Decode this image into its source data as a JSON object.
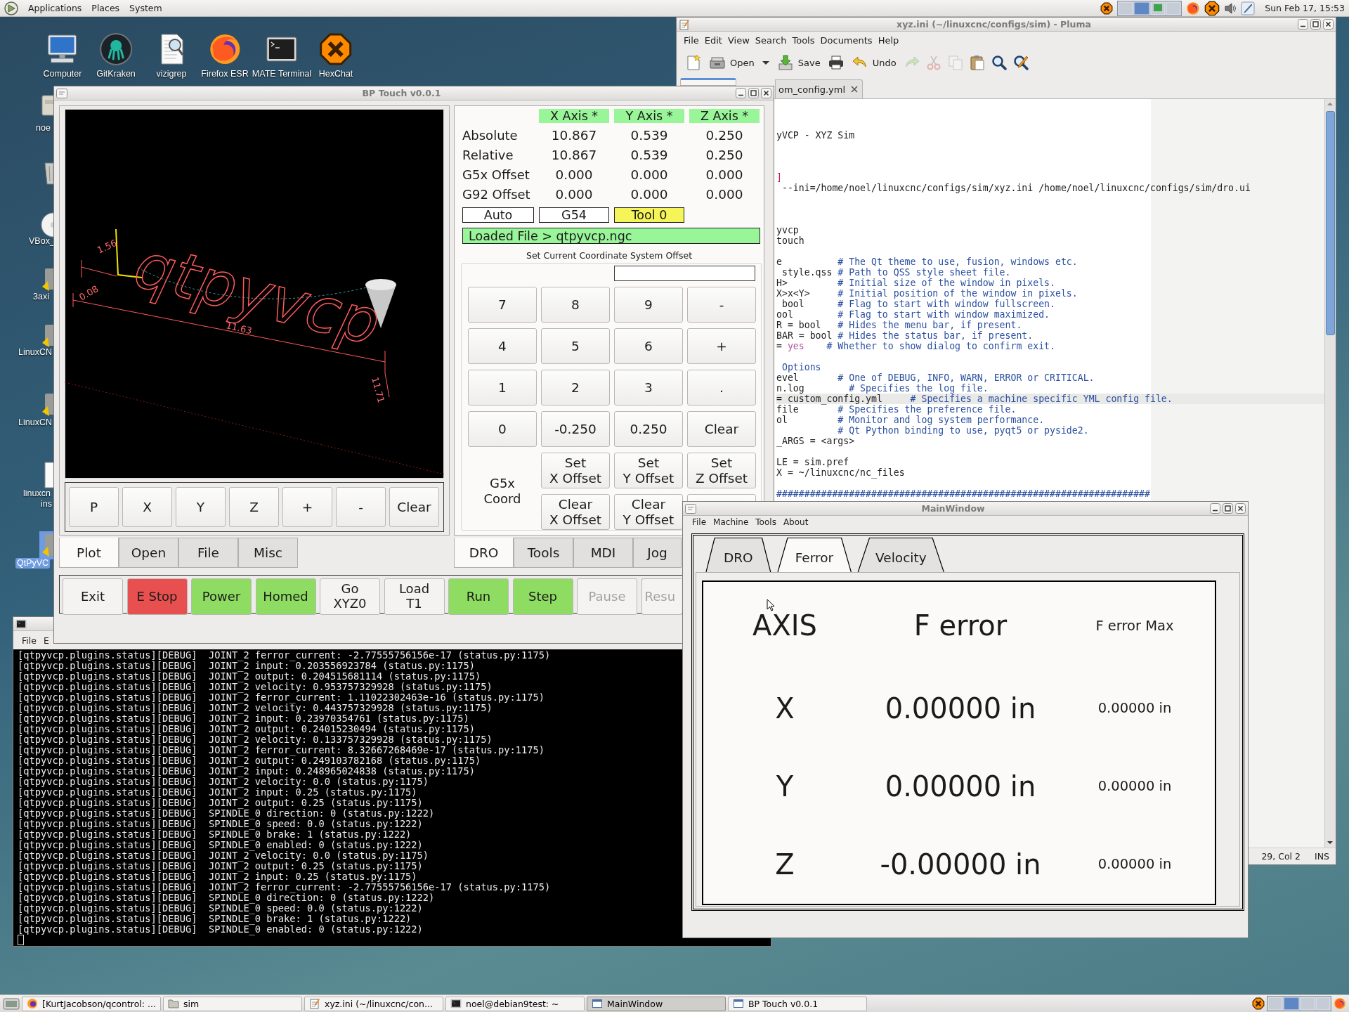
{
  "top_panel": {
    "menus": [
      "Applications",
      "Places",
      "System"
    ],
    "clock": "Sun Feb 17, 15:53"
  },
  "desktop_icons": [
    {
      "label": "Computer",
      "kind": "computer"
    },
    {
      "label": "GitKraken",
      "kind": "gitkraken"
    },
    {
      "label": "vizigrep",
      "kind": "document-search"
    },
    {
      "label": "Firefox ESR",
      "kind": "firefox"
    },
    {
      "label": "MATE Terminal",
      "kind": "terminal"
    },
    {
      "label": "HexChat",
      "kind": "hexchat"
    }
  ],
  "desktop_left_icons": [
    {
      "kind": "home-folder",
      "lines": [
        "noe"
      ],
      "selected": false
    },
    {
      "kind": "trash",
      "selected": false
    },
    {
      "kind": "disc",
      "lines": [
        "VBox_"
      ],
      "selected": false
    },
    {
      "kind": "launcher",
      "lines": [
        "3axi"
      ],
      "selected": false
    },
    {
      "kind": "launcher",
      "lines": [
        "LinuxCN"
      ],
      "selected": false
    },
    {
      "kind": "launcher",
      "lines": [
        "LinuxCN"
      ],
      "selected": false
    },
    {
      "kind": "document",
      "lines": [
        "linuxcn",
        "ins"
      ],
      "selected": false
    },
    {
      "kind": "launcher",
      "lines": [
        "QtPyVC"
      ],
      "selected": true
    }
  ],
  "pluma": {
    "title": "xyz.ini (~/linuxcnc/configs/sim) - Pluma",
    "menus": [
      "File",
      "Edit",
      "View",
      "Search",
      "Tools",
      "Documents",
      "Help"
    ],
    "toolbar": [
      {
        "kind": "new",
        "disabled": false
      },
      {
        "kind": "open",
        "label": "Open",
        "disabled": false
      },
      {
        "kind": "dropdown",
        "disabled": false
      },
      {
        "kind": "save",
        "label": "Save",
        "disabled": false
      },
      {
        "kind": "print",
        "disabled": false
      },
      {
        "kind": "undo",
        "label": "Undo",
        "disabled": false
      },
      {
        "kind": "redo",
        "disabled": true
      },
      {
        "kind": "cut",
        "disabled": true
      },
      {
        "kind": "copy",
        "disabled": true
      },
      {
        "kind": "paste",
        "disabled": false
      },
      {
        "kind": "find",
        "disabled": false
      },
      {
        "kind": "replace",
        "disabled": false
      }
    ],
    "tab": "om_config.yml",
    "lines": [
      {
        "kind": "text",
        "current": false,
        "segments": [
          {
            "kind": "code",
            "text": "yVCP - XYZ Sim"
          }
        ]
      },
      {
        "kind": "blank",
        "current": false
      },
      {
        "kind": "blank",
        "current": false
      },
      {
        "kind": "blank",
        "current": false
      },
      {
        "kind": "text",
        "current": false,
        "segments": [
          {
            "kind": "section",
            "text": "]"
          }
        ]
      },
      {
        "kind": "text",
        "current": false,
        "segments": [
          {
            "kind": "code",
            "text": " --ini=/home/noel/linuxcnc/configs/sim/xyz.ini /home/noel/linuxcnc/configs/sim/dro.ui"
          }
        ]
      },
      {
        "kind": "blank",
        "current": false
      },
      {
        "kind": "blank",
        "current": false
      },
      {
        "kind": "blank",
        "current": false
      },
      {
        "kind": "text",
        "current": false,
        "segments": [
          {
            "kind": "code",
            "text": "yvcp"
          }
        ]
      },
      {
        "kind": "text",
        "current": false,
        "segments": [
          {
            "kind": "code",
            "text": "touch"
          }
        ]
      },
      {
        "kind": "blank",
        "current": false
      },
      {
        "kind": "text",
        "current": false,
        "segments": [
          {
            "kind": "code",
            "text": "e          "
          },
          {
            "kind": "comment",
            "text": "# The Qt theme to use, fusion, windows etc."
          }
        ]
      },
      {
        "kind": "text",
        "current": false,
        "segments": [
          {
            "kind": "code",
            "text": " style.qss "
          },
          {
            "kind": "comment",
            "text": "# Path to QSS style sheet file."
          }
        ]
      },
      {
        "kind": "text",
        "current": false,
        "segments": [
          {
            "kind": "code",
            "text": "H>         "
          },
          {
            "kind": "comment",
            "text": "# Initial size of the window in pixels."
          }
        ]
      },
      {
        "kind": "text",
        "current": false,
        "segments": [
          {
            "kind": "code",
            "text": "X>x<Y>     "
          },
          {
            "kind": "comment",
            "text": "# Initial position of the window in pixels."
          }
        ]
      },
      {
        "kind": "text",
        "current": false,
        "segments": [
          {
            "kind": "code",
            "text": " bool      "
          },
          {
            "kind": "comment",
            "text": "# Flag to start with window fullscreen."
          }
        ]
      },
      {
        "kind": "text",
        "current": false,
        "segments": [
          {
            "kind": "code",
            "text": "ool        "
          },
          {
            "kind": "comment",
            "text": "# Flag to start with window maximized."
          }
        ]
      },
      {
        "kind": "text",
        "current": false,
        "segments": [
          {
            "kind": "code",
            "text": "R = bool   "
          },
          {
            "kind": "comment",
            "text": "# Hides the menu bar, if present."
          }
        ]
      },
      {
        "kind": "text",
        "current": false,
        "segments": [
          {
            "kind": "code",
            "text": "BAR = bool "
          },
          {
            "kind": "comment",
            "text": "# Hides the status bar, if present."
          }
        ]
      },
      {
        "kind": "text",
        "current": false,
        "segments": [
          {
            "kind": "code",
            "text": "= "
          },
          {
            "kind": "value",
            "text": "yes"
          },
          {
            "kind": "comment",
            "text": "    # Whether to show dialog to confirm exit."
          }
        ]
      },
      {
        "kind": "blank",
        "current": false
      },
      {
        "kind": "text",
        "current": false,
        "segments": [
          {
            "kind": "comment",
            "text": " Options"
          }
        ]
      },
      {
        "kind": "text",
        "current": false,
        "segments": [
          {
            "kind": "code",
            "text": "evel       "
          },
          {
            "kind": "comment",
            "text": "# One of DEBUG, INFO, WARN, ERROR or CRITICAL."
          }
        ]
      },
      {
        "kind": "text",
        "current": false,
        "segments": [
          {
            "kind": "code",
            "text": "n.log        "
          },
          {
            "kind": "comment",
            "text": "# Specifies the log file."
          }
        ]
      },
      {
        "kind": "text",
        "current": true,
        "segments": [
          {
            "kind": "code",
            "text": "= custom_config.yml     "
          },
          {
            "kind": "comment",
            "text": "# Specifies a machine specific YML config file."
          }
        ]
      },
      {
        "kind": "text",
        "current": false,
        "segments": [
          {
            "kind": "code",
            "text": "file       "
          },
          {
            "kind": "comment",
            "text": "# Specifies the preference file."
          }
        ]
      },
      {
        "kind": "text",
        "current": false,
        "segments": [
          {
            "kind": "code",
            "text": "ol         "
          },
          {
            "kind": "comment",
            "text": "# Monitor and log system performance."
          }
        ]
      },
      {
        "kind": "text",
        "current": false,
        "segments": [
          {
            "kind": "comment",
            "text": "           # Qt Python binding to use, pyqt5 or pyside2."
          }
        ]
      },
      {
        "kind": "text",
        "current": false,
        "segments": [
          {
            "kind": "code",
            "text": "_ARGS = <args>"
          }
        ]
      },
      {
        "kind": "blank",
        "current": false
      },
      {
        "kind": "text",
        "current": false,
        "segments": [
          {
            "kind": "code",
            "text": "LE = sim.pref"
          }
        ]
      },
      {
        "kind": "text",
        "current": false,
        "segments": [
          {
            "kind": "code",
            "text": "X = ~/linuxcnc/nc_files"
          }
        ]
      },
      {
        "kind": "blank",
        "current": false
      },
      {
        "kind": "text",
        "current": false,
        "segments": [
          {
            "kind": "comment",
            "text": "###################################################################"
          }
        ]
      }
    ],
    "status": {
      "position": "29, Col 2",
      "mode": "INS"
    }
  },
  "terminal": {
    "menus": [
      "File",
      "E"
    ],
    "lines": [
      "[qtpyvcp.plugins.status][DEBUG]  JOINT_2 ferror_current: -2.77555756156e-17 (status.py:1175)",
      "[qtpyvcp.plugins.status][DEBUG]  JOINT_2 input: 0.203556923784 (status.py:1175)",
      "[qtpyvcp.plugins.status][DEBUG]  JOINT_2 output: 0.204515681114 (status.py:1175)",
      "[qtpyvcp.plugins.status][DEBUG]  JOINT_2 velocity: 0.953757329928 (status.py:1175)",
      "[qtpyvcp.plugins.status][DEBUG]  JOINT_2 ferror_current: 1.11022302463e-16 (status.py:1175)",
      "[qtpyvcp.plugins.status][DEBUG]  JOINT_2 velocity: 0.443757329928 (status.py:1175)",
      "[qtpyvcp.plugins.status][DEBUG]  JOINT_2 input: 0.23970354761 (status.py:1175)",
      "[qtpyvcp.plugins.status][DEBUG]  JOINT_2 output: 0.24015230494 (status.py:1175)",
      "[qtpyvcp.plugins.status][DEBUG]  JOINT_2 velocity: 0.133757329928 (status.py:1175)",
      "[qtpyvcp.plugins.status][DEBUG]  JOINT_2 ferror_current: 8.32667268469e-17 (status.py:1175)",
      "[qtpyvcp.plugins.status][DEBUG]  JOINT_2 output: 0.249103782168 (status.py:1175)",
      "[qtpyvcp.plugins.status][DEBUG]  JOINT_2 input: 0.248965024838 (status.py:1175)",
      "[qtpyvcp.plugins.status][DEBUG]  JOINT_2 velocity: 0.0 (status.py:1175)",
      "[qtpyvcp.plugins.status][DEBUG]  JOINT_2 input: 0.25 (status.py:1175)",
      "[qtpyvcp.plugins.status][DEBUG]  JOINT_2 output: 0.25 (status.py:1175)",
      "[qtpyvcp.plugins.status][DEBUG]  SPINDLE_0 direction: 0 (status.py:1222)",
      "[qtpyvcp.plugins.status][DEBUG]  SPINDLE_0 speed: 0.0 (status.py:1222)",
      "[qtpyvcp.plugins.status][DEBUG]  SPINDLE_0 brake: 1 (status.py:1222)",
      "[qtpyvcp.plugins.status][DEBUG]  SPINDLE_0 enabled: 0 (status.py:1222)",
      "[qtpyvcp.plugins.status][DEBUG]  JOINT_2 velocity: 0.0 (status.py:1175)",
      "[qtpyvcp.plugins.status][DEBUG]  JOINT_2 output: 0.25 (status.py:1175)",
      "[qtpyvcp.plugins.status][DEBUG]  JOINT_2 input: 0.25 (status.py:1175)",
      "[qtpyvcp.plugins.status][DEBUG]  JOINT_2 ferror_current: -2.77555756156e-17 (status.py:1175)",
      "[qtpyvcp.plugins.status][DEBUG]  SPINDLE_0 direction: 0 (status.py:1222)",
      "[qtpyvcp.plugins.status][DEBUG]  SPINDLE_0 speed: 0.0 (status.py:1222)",
      "[qtpyvcp.plugins.status][DEBUG]  SPINDLE_0 brake: 1 (status.py:1222)",
      "[qtpyvcp.plugins.status][DEBUG]  SPINDLE_0 enabled: 0 (status.py:1222)"
    ]
  },
  "bp_touch": {
    "title": "BP Touch v0.0.1",
    "plot": {
      "toolpath_text": "qtpyvcp",
      "dimension_labels": [
        "11.63",
        "11.71",
        "1.56",
        "0.08"
      ]
    },
    "jog_buttons": [
      "P",
      "X",
      "Y",
      "Z",
      "+",
      "-",
      "Clear"
    ],
    "left_tabs": [
      {
        "label": "Plot",
        "selected": true
      },
      {
        "label": "Open",
        "selected": false
      },
      {
        "label": "File",
        "selected": false
      },
      {
        "label": "Misc",
        "selected": false
      }
    ],
    "dro": {
      "columns": [
        "X Axis *",
        "Y Axis *",
        "Z Axis *"
      ],
      "rows": [
        {
          "label": "Absolute",
          "values": [
            "10.867",
            "0.539",
            "0.250"
          ]
        },
        {
          "label": "Relative",
          "values": [
            "10.867",
            "0.539",
            "0.250"
          ]
        },
        {
          "label": "G5x Offset",
          "values": [
            "0.000",
            "0.000",
            "0.000"
          ]
        },
        {
          "label": "G92 Offset",
          "values": [
            "0.000",
            "0.000",
            "0.000"
          ]
        }
      ]
    },
    "status_fields": [
      {
        "text": "Auto",
        "color": "#ffffff"
      },
      {
        "text": "G54",
        "color": "#ffffff"
      },
      {
        "text": "Tool 0",
        "color": "#f5f55a"
      }
    ],
    "loaded_file": "Loaded File > qtpyvcp.ngc",
    "offset_label": "Set Current Coordinate System Offset",
    "keypad": [
      "7",
      "8",
      "9",
      "-",
      "4",
      "5",
      "6",
      "+",
      "1",
      "2",
      "3",
      ".",
      "0",
      "-0.250",
      "0.250",
      "Clear"
    ],
    "coord_label": "G5x Coord",
    "offset_buttons": [
      {
        "lines": [
          "Set",
          "X Offset"
        ]
      },
      {
        "lines": [
          "Set",
          "Y Offset"
        ]
      },
      {
        "lines": [
          "Set",
          "Z Offset"
        ]
      },
      {
        "lines": [
          "Clear",
          "X Offset"
        ]
      },
      {
        "lines": [
          "Clear",
          "Y Offset"
        ]
      }
    ],
    "right_tabs": [
      {
        "label": "DRO",
        "selected": true
      },
      {
        "label": "Tools",
        "selected": false
      },
      {
        "label": "MDI",
        "selected": false
      },
      {
        "label": "Jog",
        "selected": false
      }
    ],
    "actions": [
      {
        "lines": [
          "Exit"
        ],
        "color": "#f4f3f2",
        "disabled": false
      },
      {
        "lines": [
          "E Stop"
        ],
        "color": "#e85050",
        "disabled": false
      },
      {
        "lines": [
          "Power"
        ],
        "color": "#8fdc62",
        "disabled": false
      },
      {
        "lines": [
          "Homed"
        ],
        "color": "#8fdc62",
        "disabled": false
      },
      {
        "lines": [
          "Go",
          "XYZ0"
        ],
        "color": "#f4f3f2",
        "disabled": false
      },
      {
        "lines": [
          "Load",
          "T1"
        ],
        "color": "#f4f3f2",
        "disabled": false
      },
      {
        "lines": [
          "Run"
        ],
        "color": "#8fdc62",
        "disabled": false
      },
      {
        "lines": [
          "Step"
        ],
        "color": "#8fdc62",
        "disabled": false
      },
      {
        "lines": [
          "Pause"
        ],
        "color": "#f4f3f2",
        "disabled": true
      },
      {
        "lines": [
          "Resu"
        ],
        "color": "#f4f3f2",
        "disabled": true
      }
    ]
  },
  "main_window": {
    "title": "MainWindow",
    "menus": [
      "File",
      "Machine",
      "Tools",
      "About"
    ],
    "tabs": [
      {
        "label": "DRO",
        "selected": false
      },
      {
        "label": "Ferror",
        "selected": true
      },
      {
        "label": "Velocity",
        "selected": false
      }
    ],
    "table": {
      "columns": [
        "AXIS",
        "F error",
        "F error Max"
      ],
      "rows": [
        {
          "axis": "X",
          "ferror": "0.00000 in",
          "max": "0.00000 in"
        },
        {
          "axis": "Y",
          "ferror": "0.00000 in",
          "max": "0.00000 in"
        },
        {
          "axis": "Z",
          "ferror": "-0.00000 in",
          "max": "0.00000 in"
        }
      ]
    }
  },
  "taskbar": {
    "items": [
      {
        "label": "[KurtJacobson/qcontrol: ...",
        "kind": "browser",
        "selected": false
      },
      {
        "label": "sim",
        "kind": "folder",
        "selected": false
      },
      {
        "label": "xyz.ini (~/linuxcnc/con...",
        "kind": "editor",
        "selected": false
      },
      {
        "label": "noel@debian9test: ~",
        "kind": "terminal",
        "selected": false
      },
      {
        "label": "MainWindow",
        "kind": "window",
        "selected": true
      },
      {
        "label": "BP Touch v0.0.1",
        "kind": "window",
        "selected": false
      }
    ]
  }
}
